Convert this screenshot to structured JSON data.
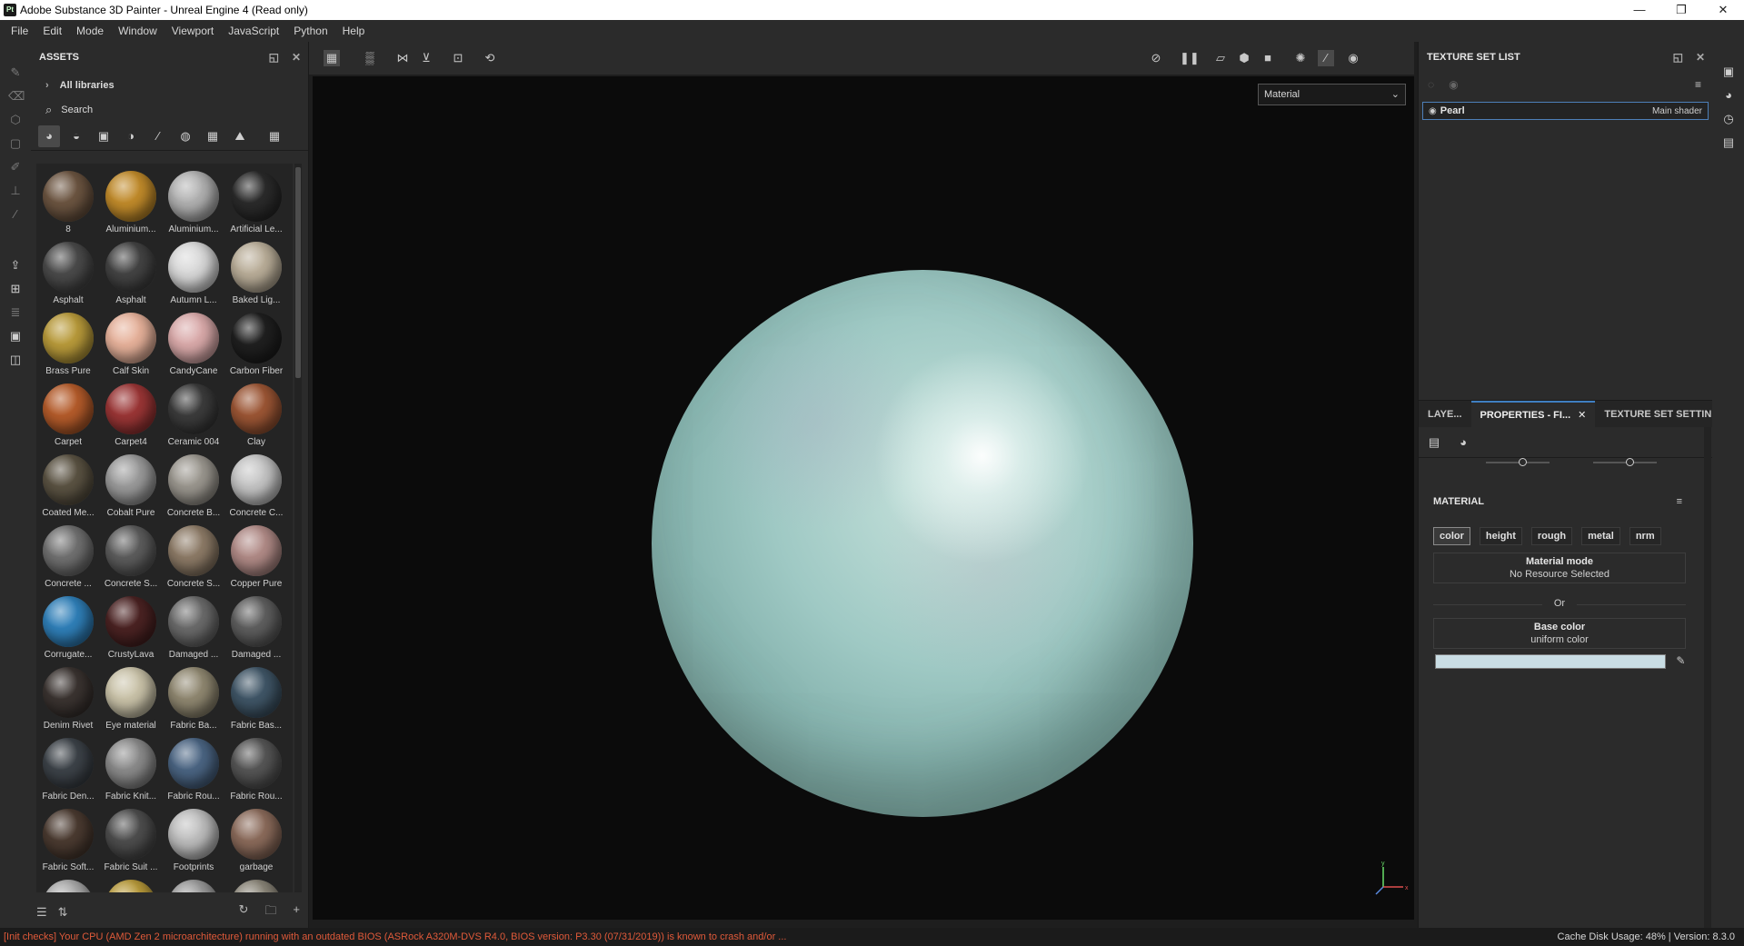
{
  "window": {
    "app_icon": "Pt",
    "title": "Adobe Substance 3D Painter - Unreal Engine 4 (Read only)",
    "controls": [
      "minimize-icon",
      "restore-icon",
      "close-icon"
    ]
  },
  "menu": [
    "File",
    "Edit",
    "Mode",
    "Window",
    "Viewport",
    "JavaScript",
    "Python",
    "Help"
  ],
  "assets": {
    "title": "ASSETS",
    "library": "All libraries",
    "search_placeholder": "Search",
    "items": [
      {
        "label": "8",
        "color": "#6b5440"
      },
      {
        "label": "Aluminium...",
        "color": "#c08a2a"
      },
      {
        "label": "Aluminium...",
        "color": "#b0b0b0"
      },
      {
        "label": "Artificial Le...",
        "color": "#2a2a2a"
      },
      {
        "label": "Asphalt",
        "color": "#4a4a4a"
      },
      {
        "label": "Asphalt",
        "color": "#434343"
      },
      {
        "label": "Autumn L...",
        "color": "#d8d8d8"
      },
      {
        "label": "Baked Lig...",
        "color": "#b9ad98"
      },
      {
        "label": "Brass Pure",
        "color": "#b89a3a"
      },
      {
        "label": "Calf Skin",
        "color": "#e6b19a"
      },
      {
        "label": "CandyCane",
        "color": "#d9a9a9"
      },
      {
        "label": "Carbon Fiber",
        "color": "#1f1f1f"
      },
      {
        "label": "Carpet",
        "color": "#b45b2a"
      },
      {
        "label": "Carpet4",
        "color": "#9a3535"
      },
      {
        "label": "Ceramic 004",
        "color": "#3b3b3b"
      },
      {
        "label": "Clay",
        "color": "#9b5534"
      },
      {
        "label": "Coated Me...",
        "color": "#5a5242"
      },
      {
        "label": "Cobalt Pure",
        "color": "#9a9a9a"
      },
      {
        "label": "Concrete B...",
        "color": "#9a968e"
      },
      {
        "label": "Concrete C...",
        "color": "#c4c4c4"
      },
      {
        "label": "Concrete ...",
        "color": "#707070"
      },
      {
        "label": "Concrete S...",
        "color": "#5c5c5c"
      },
      {
        "label": "Concrete S...",
        "color": "#8c7a66"
      },
      {
        "label": "Copper Pure",
        "color": "#b08a86"
      },
      {
        "label": "Corrugate...",
        "color": "#2f7fb8"
      },
      {
        "label": "CrustyLava",
        "color": "#4a2222"
      },
      {
        "label": "Damaged ...",
        "color": "#6a6a6a"
      },
      {
        "label": "Damaged ...",
        "color": "#5e5e5e"
      },
      {
        "label": "Denim Rivet",
        "color": "#3a3330"
      },
      {
        "label": "Eye material",
        "color": "#c9c2a8"
      },
      {
        "label": "Fabric Ba...",
        "color": "#8f8770"
      },
      {
        "label": "Fabric Bas...",
        "color": "#3f5566"
      },
      {
        "label": "Fabric Den...",
        "color": "#3c4248"
      },
      {
        "label": "Fabric Knit...",
        "color": "#8a8a8a"
      },
      {
        "label": "Fabric Rou...",
        "color": "#4a6482"
      },
      {
        "label": "Fabric Rou...",
        "color": "#555555"
      },
      {
        "label": "Fabric Soft...",
        "color": "#4a3a30"
      },
      {
        "label": "Fabric Suit ...",
        "color": "#4d4d4d"
      },
      {
        "label": "Footprints",
        "color": "#bdbdbd"
      },
      {
        "label": "garbage",
        "color": "#8a6a5a"
      },
      {
        "label": "",
        "color": "#aaaaaa"
      },
      {
        "label": "",
        "color": "#b89a3a"
      },
      {
        "label": "",
        "color": "#9a9a9a"
      },
      {
        "label": "",
        "color": "#8a8578"
      }
    ]
  },
  "viewport": {
    "mode_select": "Material",
    "axis_label": "x",
    "axis_label_y": "y"
  },
  "texture_set_list": {
    "title": "TEXTURE SET LIST",
    "rows": [
      {
        "name": "Pearl",
        "shader": "Main shader"
      }
    ]
  },
  "tabs": [
    {
      "label": "LAYE...",
      "active": false
    },
    {
      "label": "PROPERTIES - FI...",
      "active": true
    },
    {
      "label": "TEXTURE SET SETTIN...",
      "active": false
    }
  ],
  "material": {
    "title": "MATERIAL",
    "channels": [
      "color",
      "height",
      "rough",
      "metal",
      "nrm"
    ],
    "active_channel": "color",
    "mode_title": "Material mode",
    "mode_value": "No Resource Selected",
    "or_label": "Or",
    "base_color_title": "Base color",
    "base_color_value": "uniform color",
    "base_color_swatch": "#c9dde4"
  },
  "status": {
    "message": "[Init checks] Your CPU (AMD Zen 2 microarchitecture) running with an outdated BIOS (ASRock A320M-DVS R4.0, BIOS version: P3.30 (07/31/2019)) is known to crash and/or ...",
    "right": "Cache Disk Usage:      48% | Version: 8.3.0"
  }
}
